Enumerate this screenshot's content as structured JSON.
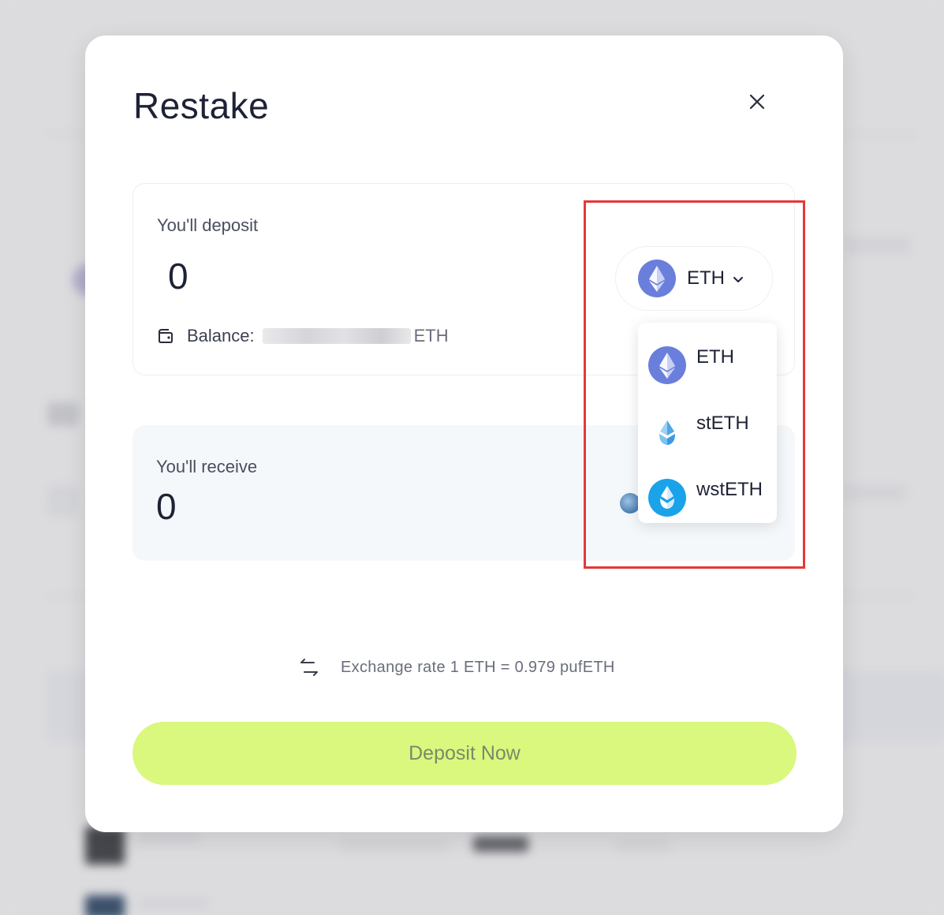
{
  "modal": {
    "title": "Restake"
  },
  "deposit": {
    "label": "You'll deposit",
    "amount": "0",
    "balance_label": "Balance:",
    "balance_unit": "ETH"
  },
  "token_select": {
    "selected": "ETH"
  },
  "dropdown": {
    "options": [
      {
        "label": "ETH",
        "icon": "eth-icon"
      },
      {
        "label": "stETH",
        "icon": "steth-icon"
      },
      {
        "label": "wstETH",
        "icon": "wsteth-icon"
      }
    ]
  },
  "receive": {
    "label": "You'll receive",
    "amount": "0"
  },
  "exchange": {
    "text": "Exchange rate 1 ETH = 0.979 pufETH"
  },
  "actions": {
    "deposit_label": "Deposit Now"
  },
  "colors": {
    "accent_button": "#d9f87d",
    "highlight_border": "#e23a3a",
    "eth_blue": "#6a7fdc",
    "wsteth_blue": "#1aa3e8"
  }
}
